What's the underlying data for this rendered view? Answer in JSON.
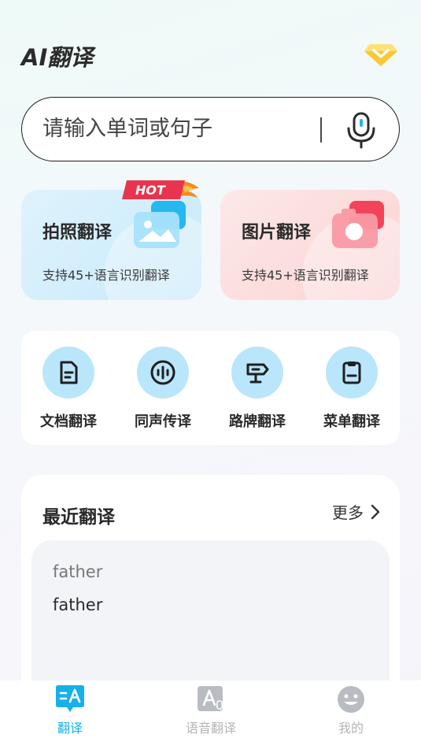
{
  "header": {
    "title": "AI翻译",
    "vip_icon": "diamond-icon"
  },
  "search": {
    "placeholder": "请输入单词或句子",
    "mic_icon": "microphone-icon"
  },
  "feature_cards": [
    {
      "title": "拍照翻译",
      "subtitle": "支持45+语言识别翻译",
      "badge": "HOT",
      "icon": "photo-icon"
    },
    {
      "title": "图片翻译",
      "subtitle": "支持45+语言识别翻译",
      "icon": "camera-icon"
    }
  ],
  "tools": [
    {
      "label": "文档翻译",
      "icon": "document-icon"
    },
    {
      "label": "同声传译",
      "icon": "voice-wave-icon"
    },
    {
      "label": "路牌翻译",
      "icon": "signpost-icon"
    },
    {
      "label": "菜单翻译",
      "icon": "menu-clipboard-icon"
    }
  ],
  "recent": {
    "title": "最近翻译",
    "more_label": "更多",
    "items": [
      {
        "source": "father",
        "target": "father"
      }
    ]
  },
  "bottom_nav": [
    {
      "label": "翻译",
      "icon": "translate-icon",
      "active": true
    },
    {
      "label": "语音翻译",
      "icon": "voice-translate-icon",
      "active": false
    },
    {
      "label": "我的",
      "icon": "profile-icon",
      "active": false
    }
  ],
  "colors": {
    "accent": "#19b0e8",
    "tool_circle": "#b9e6fb",
    "hot": "#e8344e"
  }
}
